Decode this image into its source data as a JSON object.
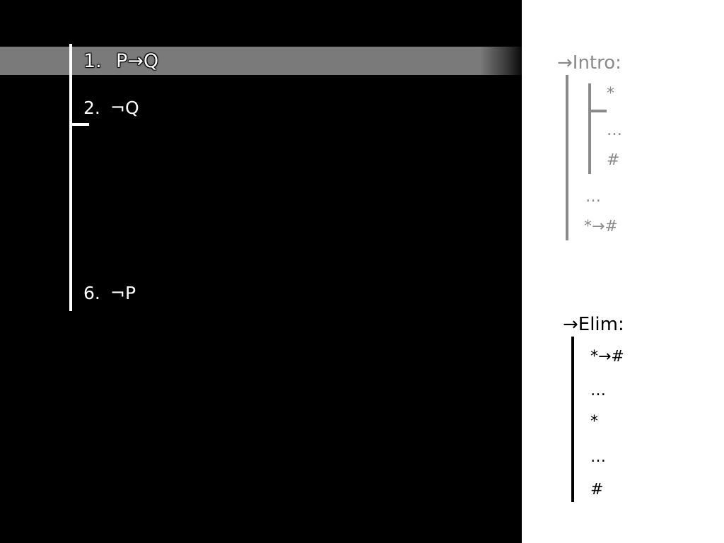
{
  "proof": {
    "lines": [
      {
        "number": "1.",
        "formula": "P→Q",
        "highlighted": true
      },
      {
        "number": "2.",
        "formula": "¬Q",
        "highlighted": false
      },
      {
        "number": "6.",
        "formula": "¬P",
        "highlighted": false
      }
    ]
  },
  "rules": {
    "intro": {
      "title": "→Intro:",
      "assumption": "*",
      "inner_dots": "…",
      "inner_result": "#",
      "outer_dots": "…",
      "conclusion": "*→#",
      "color": "#8a8a8a"
    },
    "elim": {
      "title": "→Elim:",
      "conditional": "*→#",
      "dots_1": "…",
      "antecedent": "*",
      "dots_2": "…",
      "consequent": "#",
      "color": "#000000"
    }
  },
  "colors": {
    "background": "#000000",
    "rules_panel": "#ffffff",
    "highlight": "#7a7a7a"
  }
}
